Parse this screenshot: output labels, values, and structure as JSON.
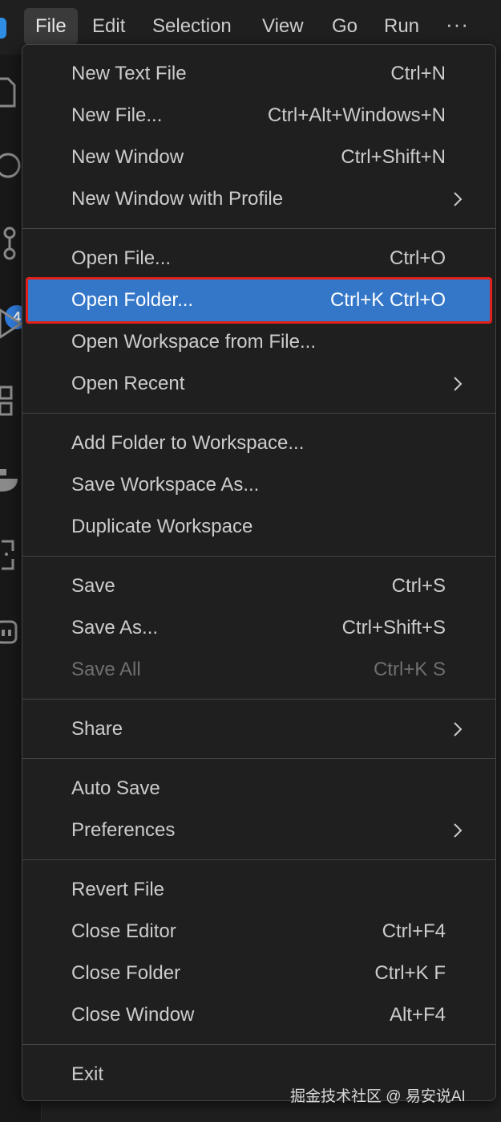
{
  "menubar": {
    "items": [
      "File",
      "Edit",
      "Selection",
      "View",
      "Go",
      "Run"
    ],
    "more": "···"
  },
  "activity": {
    "badge": "4"
  },
  "file_menu": {
    "items": [
      {
        "label": "New Text File",
        "shortcut": "Ctrl+N"
      },
      {
        "label": "New File...",
        "shortcut": "Ctrl+Alt+Windows+N"
      },
      {
        "label": "New Window",
        "shortcut": "Ctrl+Shift+N"
      },
      {
        "label": "New Window with Profile",
        "shortcut": ""
      },
      {
        "label": "Open File...",
        "shortcut": "Ctrl+O"
      },
      {
        "label": "Open Folder...",
        "shortcut": "Ctrl+K Ctrl+O"
      },
      {
        "label": "Open Workspace from File...",
        "shortcut": ""
      },
      {
        "label": "Open Recent",
        "shortcut": ""
      },
      {
        "label": "Add Folder to Workspace...",
        "shortcut": ""
      },
      {
        "label": "Save Workspace As...",
        "shortcut": ""
      },
      {
        "label": "Duplicate Workspace",
        "shortcut": ""
      },
      {
        "label": "Save",
        "shortcut": "Ctrl+S"
      },
      {
        "label": "Save As...",
        "shortcut": "Ctrl+Shift+S"
      },
      {
        "label": "Save All",
        "shortcut": "Ctrl+K S"
      },
      {
        "label": "Share",
        "shortcut": ""
      },
      {
        "label": "Auto Save",
        "shortcut": ""
      },
      {
        "label": "Preferences",
        "shortcut": ""
      },
      {
        "label": "Revert File",
        "shortcut": ""
      },
      {
        "label": "Close Editor",
        "shortcut": "Ctrl+F4"
      },
      {
        "label": "Close Folder",
        "shortcut": "Ctrl+K F"
      },
      {
        "label": "Close Window",
        "shortcut": "Alt+F4"
      },
      {
        "label": "Exit",
        "shortcut": ""
      }
    ]
  },
  "watermark": "掘金技术社区 @ 易安说AI",
  "colors": {
    "highlight": "#3477c9",
    "highlight_outline": "#e0201c",
    "menu_bg": "#1f1f1f",
    "badge": "#2f7ad9"
  }
}
